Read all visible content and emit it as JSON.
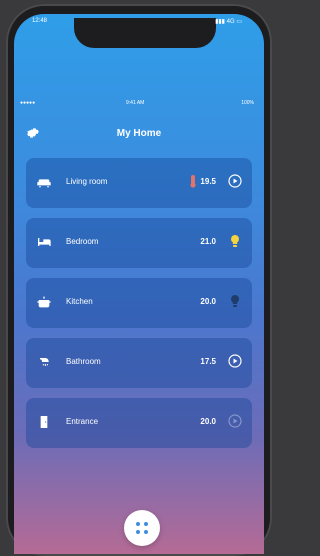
{
  "outer_status": {
    "time": "12:48",
    "icons": "4G"
  },
  "inner_status": {
    "carrier": "●●●●● ",
    "time": "9:41 AM",
    "battery": "100%"
  },
  "header": {
    "title": "My Home"
  },
  "rooms": [
    {
      "name": "Living room",
      "temp": "19.5",
      "icon": "sofa-icon",
      "status_icon": "heating-icon",
      "indicator_icon": "play-circle-icon"
    },
    {
      "name": "Bedroom",
      "temp": "21.0",
      "icon": "bed-icon",
      "status_icon": "lightbulb-on-icon"
    },
    {
      "name": "Kitchen",
      "temp": "20.0",
      "icon": "cooking-pot-icon",
      "status_icon": "lightbulb-off-icon"
    },
    {
      "name": "Bathroom",
      "temp": "17.5",
      "icon": "shower-icon",
      "status_icon": "play-circle-icon"
    },
    {
      "name": "Entrance",
      "temp": "20.0",
      "icon": "door-icon",
      "status_icon": "play-circle-icon"
    }
  ],
  "colors": {
    "lightbulb_on": "#f7d23a",
    "lightbulb_off": "#1f3d6a",
    "heating": "#e0746a"
  }
}
